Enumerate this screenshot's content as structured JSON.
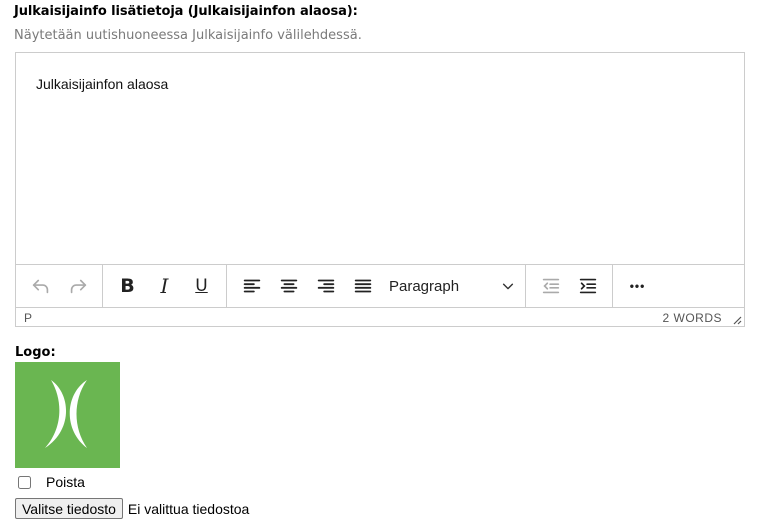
{
  "field": {
    "label": "Julkaisijainfo lisätietoja (Julkaisijainfon alaosa):",
    "help": "Näytetään uutishuoneessa Julkaisijainfo välilehdessä."
  },
  "editor": {
    "content": "Julkaisijainfon alaosa",
    "toolbar": {
      "undo_icon": "undo-icon",
      "redo_icon": "redo-icon",
      "bold_label": "B",
      "italic_label": "I",
      "underline_label": "U",
      "block_format": "Paragraph",
      "more_label": "•••"
    },
    "status": {
      "path": "P",
      "word_count": "2 WORDS"
    }
  },
  "logo": {
    "label": "Logo:",
    "colors": {
      "background": "#6ab651",
      "mark": "#ffffff"
    }
  },
  "remove": {
    "label": "Poista",
    "checked": false
  },
  "file": {
    "button_label": "Valitse tiedosto",
    "status": "Ei valittua tiedostoa"
  }
}
